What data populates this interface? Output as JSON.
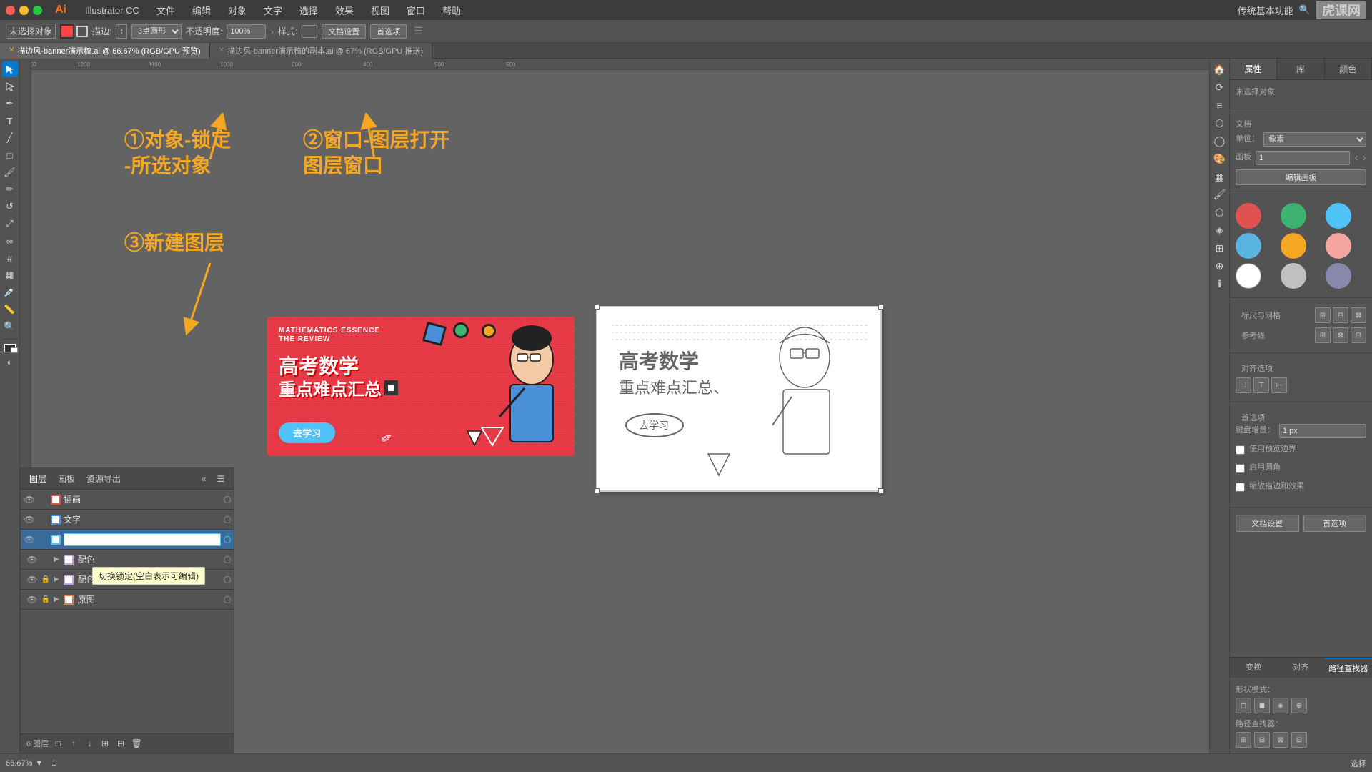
{
  "app": {
    "name": "Illustrator CC",
    "logo": "Ai",
    "logo_full": "Illustrator CC"
  },
  "mac_buttons": {
    "close": "●",
    "minimize": "●",
    "maximize": "●"
  },
  "menu": {
    "items": [
      "文件",
      "编辑",
      "对象",
      "文字",
      "选择",
      "效果",
      "视图",
      "窗口",
      "帮助"
    ],
    "right": "传统基本功能"
  },
  "toolbar": {
    "no_select": "未选择对象",
    "stroke_label": "描边:",
    "shape_select": "3点圆形",
    "opacity_label": "不透明度:",
    "opacity_val": "100%",
    "style_label": "样式:",
    "doc_setting": "文档设置",
    "preference": "首选项"
  },
  "tabs": [
    {
      "label": "描边风-banner演示稿.ai @ 66.67% (RGB/GPU 预览)",
      "active": true
    },
    {
      "label": "描边风-banner演示稿的副本.ai @ 67% (RGB/GPU 推送)",
      "active": false
    }
  ],
  "annotations": {
    "ann1_text": "①对象-锁定\n-所选对象",
    "ann2_text": "②窗口-图层打开\n图层窗口",
    "ann3_text": "③新建图层"
  },
  "right_panel": {
    "tabs": [
      "属性",
      "库",
      "颜色"
    ],
    "active_tab": "属性",
    "no_select": "未选择对象",
    "doc_section": "文档",
    "unit_label": "单位：",
    "unit_val": "像素",
    "board_label": "画板",
    "board_val": "1",
    "edit_board_btn": "编辑画板",
    "color_swatches": [
      {
        "color": "#e05252",
        "name": "red"
      },
      {
        "color": "#3cb371",
        "name": "green"
      },
      {
        "color": "#4fc3f7",
        "name": "cyan"
      },
      {
        "color": "#5ab4e0",
        "name": "sky-blue"
      },
      {
        "color": "#f5a623",
        "name": "orange"
      },
      {
        "color": "#f4a5a0",
        "name": "pink"
      },
      {
        "color": "#ffffff",
        "name": "white"
      },
      {
        "color": "#c0c0c0",
        "name": "light-gray"
      },
      {
        "color": "#8888aa",
        "name": "purple-gray"
      }
    ],
    "scale_snap_title": "标尺与网格",
    "reference_title": "参考线",
    "align_title": "对齐选项",
    "prefer_title": "首选项",
    "keyboard_nudge": "键盘增量：",
    "keyboard_val": "1 px",
    "snap_border_label": "使用预览边界",
    "round_corner_label": "启用圆角",
    "raster_label": "缩放描边和效果",
    "quick_actions": {
      "doc_setting_btn": "文档设置",
      "pref_btn": "首选项"
    }
  },
  "bottom_panel_tabs": [
    "变换",
    "对齐",
    "路径查找器"
  ],
  "active_bottom_tab": "路径查找器",
  "shape_mode_title": "形状模式：",
  "path_finder_title": "路径查找器：",
  "layers_panel": {
    "tabs": [
      "图层",
      "画板",
      "资源导出"
    ],
    "active_tab": "图层",
    "layers": [
      {
        "name": "插画",
        "visible": true,
        "locked": false,
        "color": "#e05252",
        "has_sub": false,
        "editing": false
      },
      {
        "name": "文字",
        "visible": true,
        "locked": false,
        "color": "#4f9de0",
        "has_sub": false,
        "editing": false
      },
      {
        "name": "",
        "visible": true,
        "locked": false,
        "color": "#4fc3f7",
        "has_sub": false,
        "editing": true,
        "is_active": true
      },
      {
        "name": "配色",
        "visible": true,
        "locked": false,
        "color": "#c8a0e0",
        "has_sub": true,
        "editing": false
      },
      {
        "name": "配色",
        "visible": true,
        "locked": true,
        "color": "#c8a0e0",
        "has_sub": true,
        "editing": false
      },
      {
        "name": "原图",
        "visible": true,
        "locked": true,
        "color": "#e08050",
        "has_sub": true,
        "editing": false
      }
    ],
    "footer_count": "6 图层",
    "footer_btns": [
      "□",
      "↑",
      "↓",
      "⊞",
      "⊟",
      "🗑"
    ]
  },
  "tooltip": {
    "text": "切换锁定(空白表示可编辑)"
  },
  "statusbar": {
    "zoom": "66.67%",
    "board": "1",
    "select_label": "选择"
  },
  "canvas_annotations": {
    "arrow1_color": "#f5a623",
    "arrow2_color": "#f5a623",
    "arrow3_color": "#f5a623"
  },
  "banner": {
    "top_text1": "MATHEMATICS ESSENCE",
    "top_text2": "THE REVIEW",
    "main_text1": "高考数学",
    "main_text2": "重点难点汇总",
    "btn_text": "去学习",
    "cross_color": "#f5a623"
  }
}
